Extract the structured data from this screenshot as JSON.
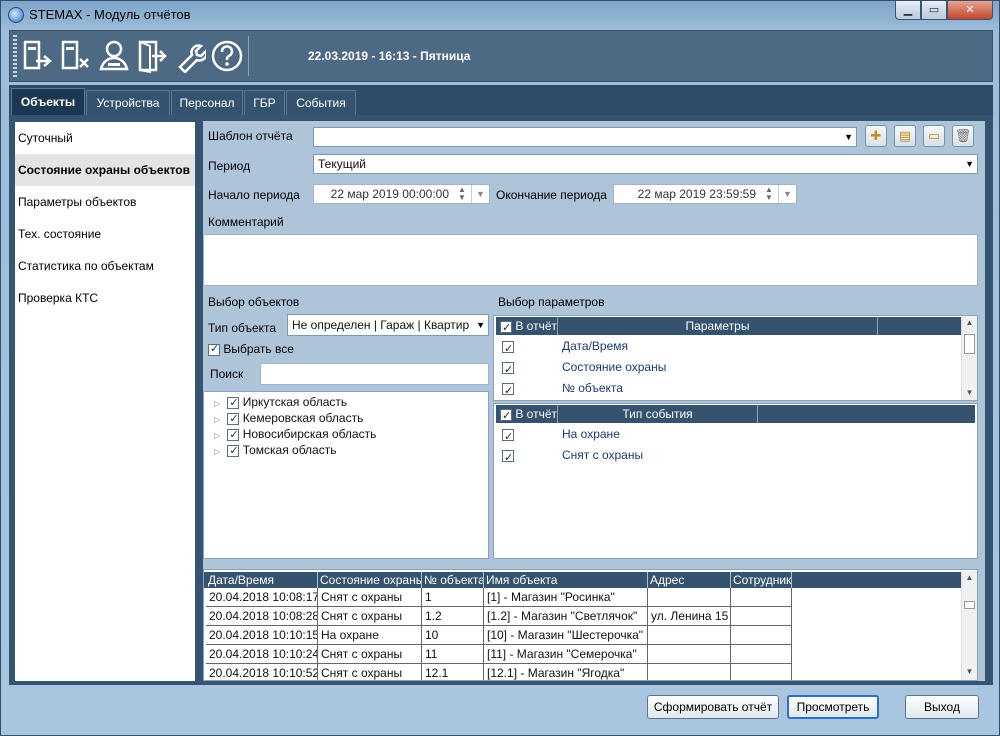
{
  "window": {
    "title": "STEMAX - Модуль отчётов"
  },
  "toolbar": {
    "icons": [
      "object-exit-icon",
      "object-delete-icon",
      "guard-user-icon",
      "exit-door-icon",
      "wrench-icon",
      "help-icon"
    ],
    "datetime": "22.03.2019 - 16:13 - Пятница"
  },
  "tabs": [
    "Объекты",
    "Устройства",
    "Персонал",
    "ГБР",
    "События"
  ],
  "active_tab": "Объекты",
  "sidebar": {
    "items": [
      "Суточный",
      "Состояние охраны объектов",
      "Параметры объектов",
      "Тех. состояние",
      "Статистика по объектам",
      "Проверка КТС"
    ],
    "active": "Состояние охраны объектов"
  },
  "form": {
    "template_label": "Шаблон отчёта",
    "template_value": "",
    "period_label": "Период",
    "period_value": "Текущий",
    "start_label": "Начало периода",
    "start_value": "22 мар 2019 00:00:00",
    "end_label": "Окончание периода",
    "end_value": "22 мар 2019 23:59:59",
    "comment_label": "Комментарий",
    "comment_value": ""
  },
  "objects": {
    "section_label": "Выбор объектов",
    "type_label": "Тип объекта",
    "type_value": "Не определен | Гараж | Квартир",
    "select_all_label": "Выбрать все",
    "search_label": "Поиск",
    "search_value": "",
    "tree": [
      "Иркутская область",
      "Кемеровская область",
      "Новосибирская область",
      "Томская область"
    ]
  },
  "params": {
    "section_label": "Выбор параметров",
    "col_in_report": "В отчёт",
    "col_params": "Параметры",
    "rows": [
      "Дата/Время",
      "Состояние охраны",
      "№ объекта"
    ],
    "col_event_type": "Тип события",
    "event_rows": [
      "На охране",
      "Снят с охраны"
    ]
  },
  "results": {
    "columns": [
      "Дата/Время",
      "Состояние охраны",
      "№ объекта",
      "Имя объекта",
      "Адрес",
      "Сотрудник"
    ],
    "rows": [
      [
        "20.04.2018 10:08:17",
        "Снят с охраны",
        "1",
        "[1] - Магазин \"Росинка\"",
        "",
        ""
      ],
      [
        "20.04.2018 10:08:28",
        "Снят с охраны",
        "1.2",
        "[1.2] - Магазин \"Светлячок\"",
        "ул. Ленина 15",
        ""
      ],
      [
        "20.04.2018 10:10:15",
        "На охране",
        "10",
        "[10] - Магазин \"Шестерочка\"",
        "",
        ""
      ],
      [
        "20.04.2018 10:10:24",
        "Снят с охраны",
        "11",
        "[11] - Магазин \"Семерочка\"",
        "",
        ""
      ],
      [
        "20.04.2018 10:10:52",
        "Снят с охраны",
        "12.1",
        "[12.1] - Магазин \"Ягодка\"",
        "",
        ""
      ]
    ]
  },
  "buttons": {
    "generate": "Сформировать отчёт",
    "preview": "Просмотреть",
    "exit": "Выход"
  }
}
